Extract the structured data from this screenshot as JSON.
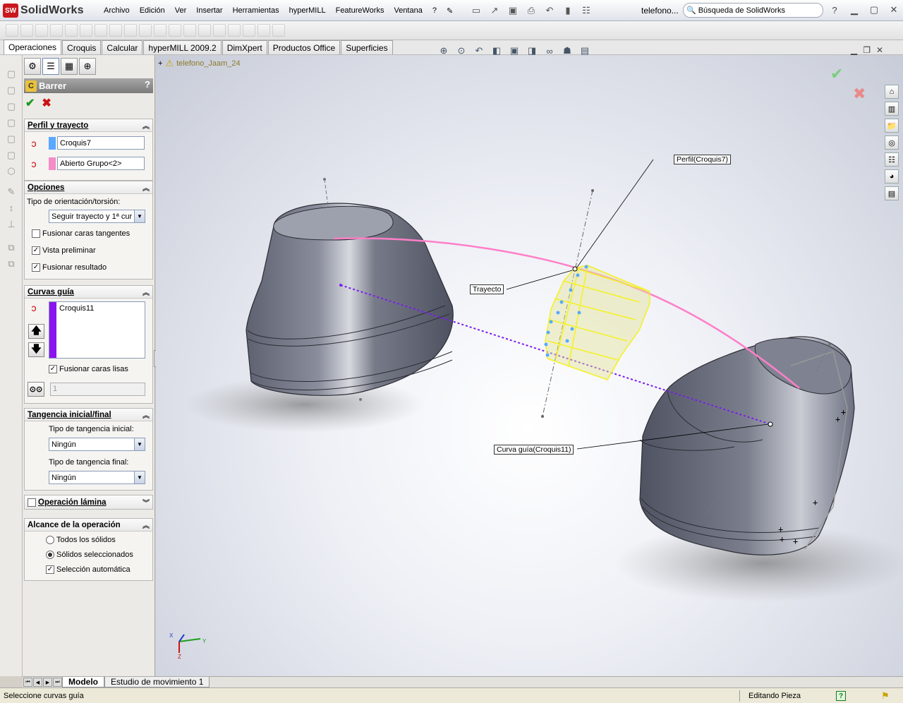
{
  "app": {
    "logo_text": "SolidWorks",
    "logo_badge": "SW"
  },
  "menu": [
    "Archivo",
    "Edición",
    "Ver",
    "Insertar",
    "Herramientas",
    "hyperMILL",
    "FeatureWorks",
    "Ventana",
    "?"
  ],
  "document_title": "telefono...",
  "search": {
    "label": "Búsqueda de SolidWorks"
  },
  "command_tabs": [
    "Operaciones",
    "Croquis",
    "Calcular",
    "hyperMILL 2009.2",
    "DimXpert",
    "Productos Office",
    "Superficies"
  ],
  "tree": {
    "part_name": "telefono_Jaam_24"
  },
  "property_manager": {
    "title": "Barrer",
    "help": "?",
    "groups": {
      "profile": {
        "title": "Perfil y trayecto",
        "profile_value": "Croquis7",
        "path_value": "Abierto Grupo<2>",
        "profile_color": "#5aa8ff",
        "path_color": "#f48cc8"
      },
      "options": {
        "title": "Opciones",
        "orientation_label": "Tipo de orientación/torsión:",
        "orientation_value": "Seguir trayecto y 1ª cur",
        "merge_tangent": {
          "label": "Fusionar caras tangentes",
          "checked": false
        },
        "preview": {
          "label": "Vista preliminar",
          "checked": true
        },
        "merge_result": {
          "label": "Fusionar resultado",
          "checked": true
        }
      },
      "guides": {
        "title": "Curvas guía",
        "items": [
          "Croquis11"
        ],
        "guide_color": "#8a14f0",
        "merge_smooth": {
          "label": "Fusionar caras lisas",
          "checked": true
        },
        "count_value": "1"
      },
      "tangency": {
        "title": "Tangencia inicial/final",
        "start_label": "Tipo de tangencia inicial:",
        "start_value": "Ningún",
        "end_label": "Tipo de tangencia final:",
        "end_value": "Ningún"
      },
      "thin": {
        "title": "Operación lámina",
        "checked": false
      },
      "scope": {
        "title": "Alcance de la operación",
        "all_bodies": {
          "label": "Todos los sólidos",
          "selected": false
        },
        "selected_bodies": {
          "label": "Sólidos seleccionados",
          "selected": true
        },
        "auto_select": {
          "label": "Selección automática",
          "checked": true
        }
      }
    }
  },
  "viewport": {
    "callouts": {
      "profile": "Perfil(Croquis7)",
      "path": "Trayecto",
      "guide": "Curva guía(Croquis11)"
    },
    "axis_labels": {
      "x": "X",
      "y": "Y",
      "z": "Z"
    },
    "colors": {
      "path": "#ff7fc8",
      "guide": "#7a1cf0",
      "preview": "#f4f12a",
      "body": "#6a6e7c"
    }
  },
  "bottom_tabs": [
    "Modelo",
    "Estudio de movimiento 1"
  ],
  "status": {
    "message": "Seleccione curvas guía",
    "mode": "Editando Pieza",
    "help": "?"
  }
}
